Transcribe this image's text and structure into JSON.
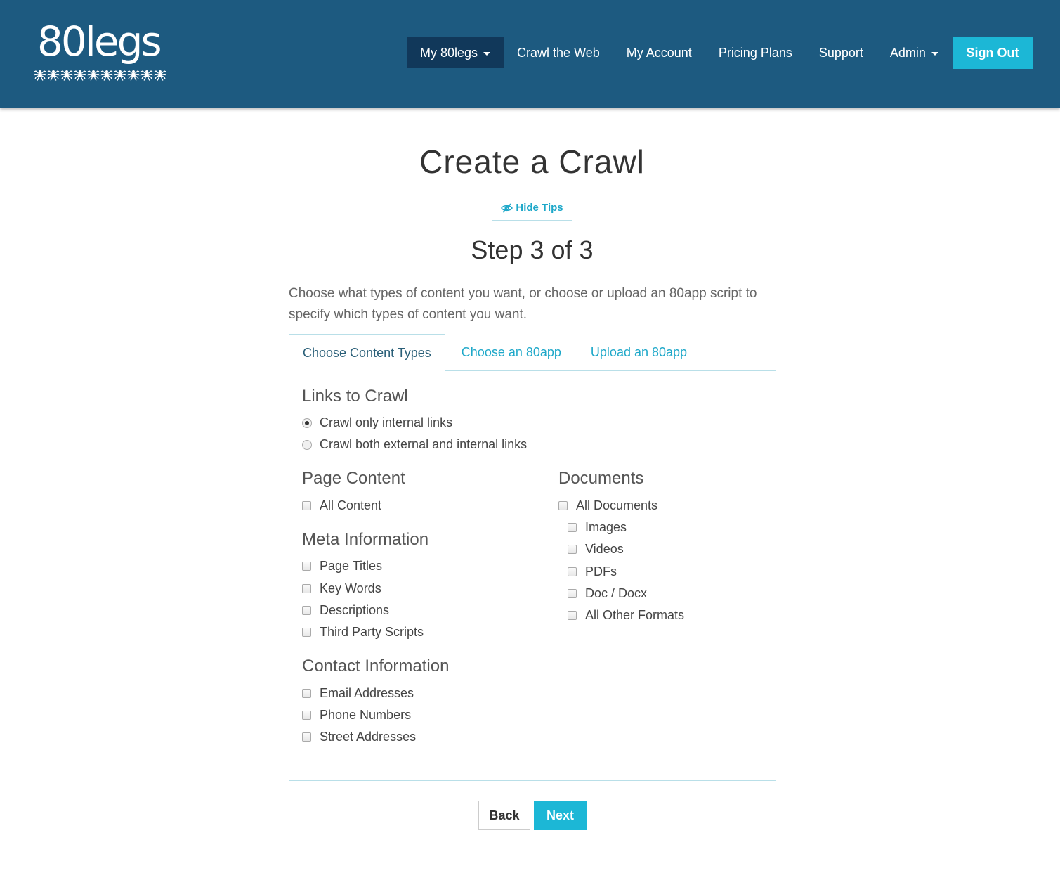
{
  "header": {
    "logo_text": "80legs",
    "nav": [
      {
        "label": "My 80legs",
        "dropdown": true,
        "active": true
      },
      {
        "label": "Crawl the Web"
      },
      {
        "label": "My Account"
      },
      {
        "label": "Pricing Plans"
      },
      {
        "label": "Support"
      },
      {
        "label": "Admin",
        "dropdown": true
      }
    ],
    "sign_out_label": "Sign Out"
  },
  "main": {
    "title": "Create a Crawl",
    "hide_tips_label": "Hide Tips",
    "step_title": "Step 3 of 3",
    "intro": "Choose what types of content you want, or choose or upload an 80app script to specify which types of content you want.",
    "tabs": [
      {
        "label": "Choose Content Types",
        "active": true
      },
      {
        "label": "Choose an 80app"
      },
      {
        "label": "Upload an 80app"
      }
    ],
    "links_to_crawl": {
      "heading": "Links to Crawl",
      "options": [
        {
          "label": "Crawl only internal links",
          "selected": true
        },
        {
          "label": "Crawl both external and internal links",
          "selected": false
        }
      ]
    },
    "page_content": {
      "heading": "Page Content",
      "options": [
        {
          "label": "All Content",
          "checked": false
        }
      ]
    },
    "meta_information": {
      "heading": "Meta Information",
      "options": [
        {
          "label": "Page Titles",
          "checked": false
        },
        {
          "label": "Key Words",
          "checked": false
        },
        {
          "label": "Descriptions",
          "checked": false
        },
        {
          "label": "Third Party Scripts",
          "checked": false
        }
      ]
    },
    "contact_information": {
      "heading": "Contact Information",
      "options": [
        {
          "label": "Email Addresses",
          "checked": false
        },
        {
          "label": "Phone Numbers",
          "checked": false
        },
        {
          "label": "Street Addresses",
          "checked": false
        }
      ]
    },
    "documents": {
      "heading": "Documents",
      "all_label": "All Documents",
      "options": [
        {
          "label": "Images",
          "checked": false
        },
        {
          "label": "Videos",
          "checked": false
        },
        {
          "label": "PDFs",
          "checked": false
        },
        {
          "label": "Doc / Docx",
          "checked": false
        },
        {
          "label": "All Other Formats",
          "checked": false
        }
      ]
    },
    "back_label": "Back",
    "next_label": "Next"
  },
  "colors": {
    "header_bg": "#1d5a80",
    "nav_active_bg": "#11385a",
    "accent": "#1cb7d6"
  }
}
